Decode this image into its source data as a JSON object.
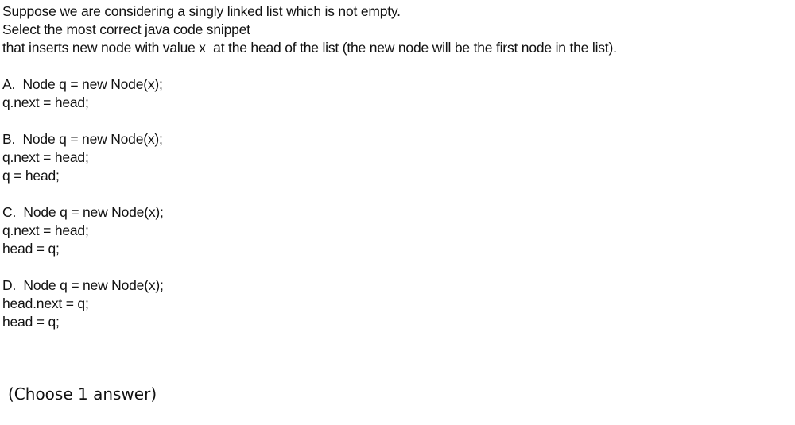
{
  "question": {
    "stem": [
      "Suppose we are considering a singly linked list which is not empty.",
      "Select the most correct java code snippet",
      "that inserts new node with value x  at the head of the list (the new node will be the first node in the list)."
    ],
    "options": [
      {
        "lines": [
          "A.  Node q = new Node(x);",
          "q.next = head;"
        ]
      },
      {
        "lines": [
          "B.  Node q = new Node(x);",
          "q.next = head;",
          "q = head;"
        ]
      },
      {
        "lines": [
          "C.  Node q = new Node(x);",
          "q.next = head;",
          "head = q;"
        ]
      },
      {
        "lines": [
          "D.  Node q = new Node(x);",
          "head.next = q;",
          "head = q;"
        ]
      }
    ]
  },
  "hint": "(Choose 1 answer)"
}
